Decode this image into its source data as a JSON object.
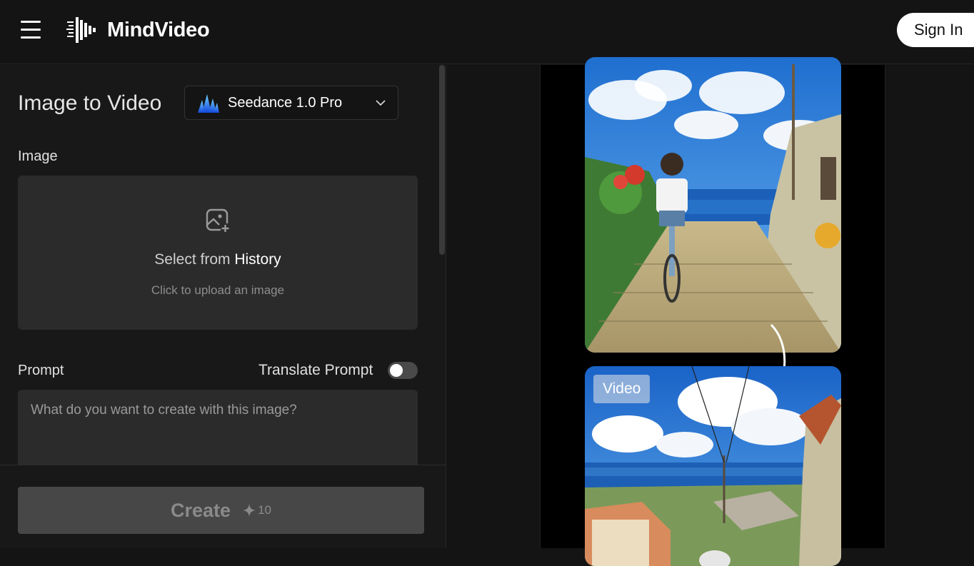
{
  "app": {
    "brand": "MindVideo"
  },
  "header": {
    "signin_label": "Sign In"
  },
  "panel": {
    "title": "Image to Video",
    "model": {
      "name": "Seedance 1.0 Pro"
    },
    "image_label": "Image",
    "upload": {
      "select_prefix": "Select from",
      "select_link": "History",
      "hint": "Click to upload an image"
    },
    "prompt_label": "Prompt",
    "translate_label": "Translate Prompt",
    "translate_enabled": false,
    "prompt_placeholder": "What do you want to create with this image?",
    "create_label": "Create",
    "credits": "10"
  },
  "preview": {
    "badge": "Video"
  },
  "colors": {
    "background": "#141414",
    "panel": "#181818",
    "button_disabled": "#474747",
    "accent_blue": "#1a8cff"
  }
}
